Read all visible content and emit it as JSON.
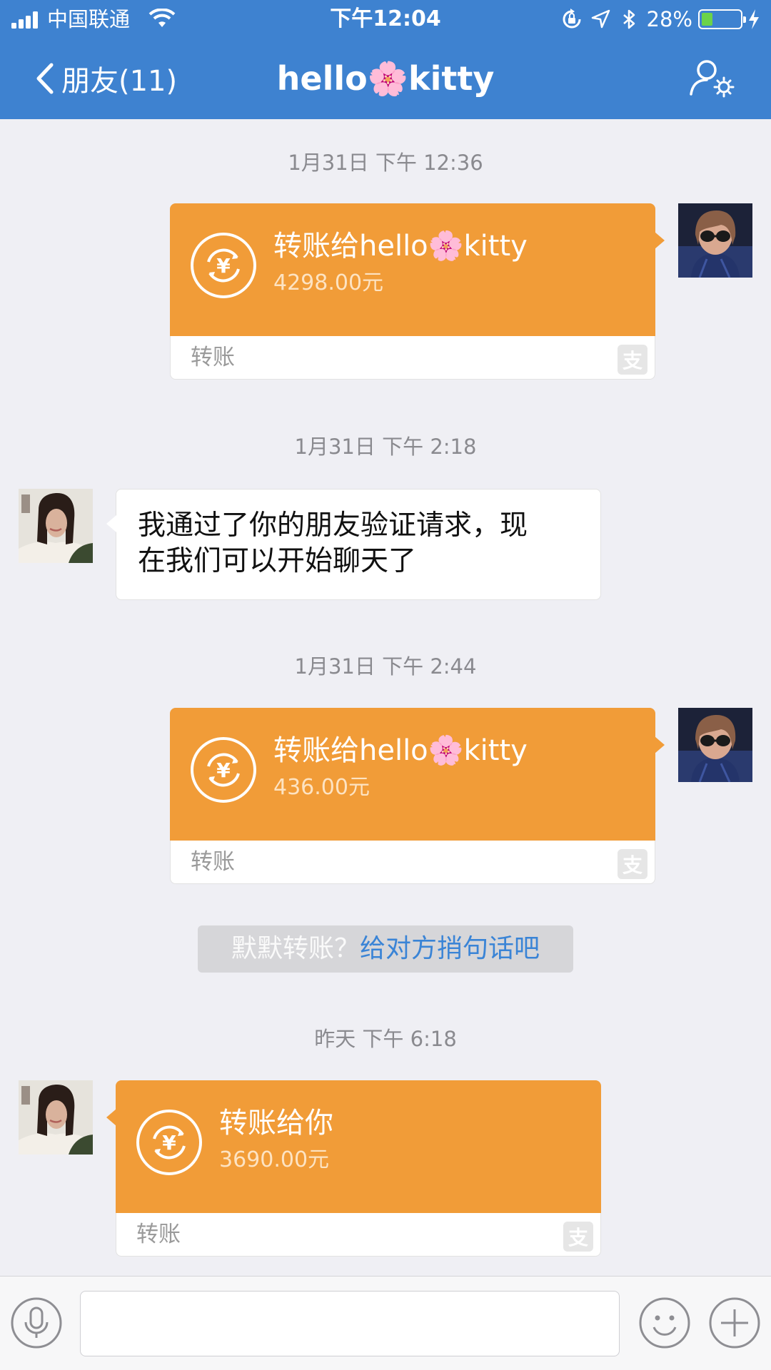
{
  "status_bar": {
    "carrier": "中国联通",
    "time": "下午12:04",
    "battery_percent": "28%",
    "battery_level": 0.28
  },
  "nav": {
    "back_label": "朋友(11)",
    "title_prefix": "hello",
    "title_emoji": "🌸",
    "title_suffix": "kitty"
  },
  "messages": [
    {
      "timestamp": "1月31日 下午 12:36",
      "direction": "out",
      "type": "transfer",
      "title_prefix": "转账给hello",
      "title_emoji": "🌸",
      "title_suffix": "kitty",
      "amount": "4298.00元",
      "label": "转账"
    },
    {
      "timestamp": "1月31日 下午 2:18",
      "direction": "in",
      "type": "text",
      "text_line1": "我通过了你的朋友验证请求，现",
      "text_line2": "在我们可以开始聊天了"
    },
    {
      "timestamp": "1月31日 下午 2:44",
      "direction": "out",
      "type": "transfer",
      "title_prefix": "转账给hello",
      "title_emoji": "🌸",
      "title_suffix": "kitty",
      "amount": "436.00元",
      "label": "转账"
    },
    {
      "timestamp": "昨天 下午 6:18",
      "direction": "in",
      "type": "transfer",
      "title": "转账给你",
      "amount": "3690.00元",
      "label": "转账"
    }
  ],
  "system_tip": {
    "muted": "默默转账？",
    "link": "给对方捎句话吧"
  },
  "icons": {
    "back": "chevron-left-icon",
    "settings": "user-settings-icon",
    "transfer": "yuan-coin-icon",
    "alipay": "alipay-icon",
    "voice": "microphone-icon",
    "emoji": "smiley-icon",
    "more": "plus-icon"
  },
  "colors": {
    "header": "#3e82d0",
    "transfer": "#f19c38",
    "link": "#3a84d6",
    "background": "#efeff4"
  }
}
